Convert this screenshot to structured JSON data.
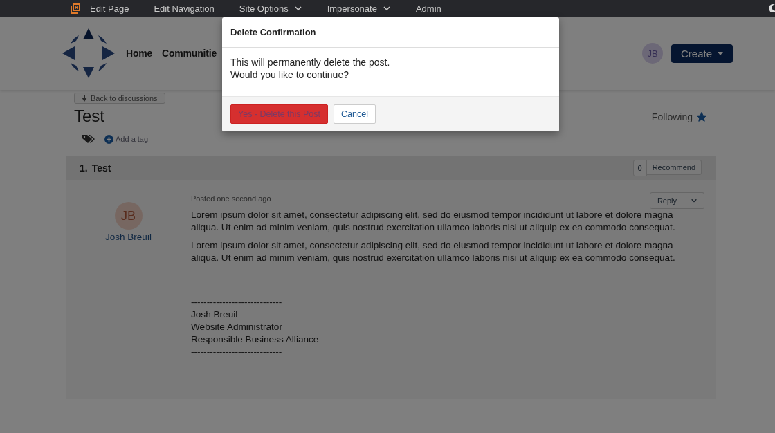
{
  "top_bar": {
    "items": [
      {
        "label": "Edit Page",
        "dropdown": false
      },
      {
        "label": "Edit Navigation",
        "dropdown": false
      },
      {
        "label": "Site Options",
        "dropdown": true
      },
      {
        "label": "Impersonate",
        "dropdown": true
      },
      {
        "label": "Admin",
        "dropdown": false
      }
    ]
  },
  "header": {
    "nav": [
      "Home",
      "Communitie"
    ],
    "avatar": "JB",
    "create_button": "Create"
  },
  "back_button": "Back to discussions",
  "discussion": {
    "title": "Test",
    "add_tag": "Add a tag",
    "following": {
      "label": "Following",
      "on": true
    }
  },
  "post": {
    "number": "1.",
    "title": "Test",
    "recommend_count": "0",
    "recommend": "Recommend",
    "author_initials": "JB",
    "author": "Josh Breuil",
    "posted": "Posted one second ago",
    "reply": "Reply",
    "paragraphs": [
      "Lorem ipsum dolor sit amet, consectetur adipiscing elit, sed do eiusmod tempor incididunt ut labore et dolore magna aliqua. Ut enim ad minim veniam, quis nostrud exercitation ullamco laboris nisi ut aliquip ex ea commodo consequat.",
      "Lorem ipsum dolor sit amet, consectetur adipiscing elit, sed do eiusmod tempor incididunt ut labore et dolore magna aliqua. Ut enim ad minim veniam, quis nostrud exercitation ullamco laboris nisi ut aliquip ex ea commodo consequat."
    ],
    "signature": [
      "-----------------------------",
      "Josh Breuil",
      "Website Administrator",
      "Responsible Business Alliance",
      "-----------------------------"
    ]
  },
  "dialog": {
    "title": "Delete Confirmation",
    "message": [
      "This will permanently delete the post.",
      "Would you like to continue?"
    ],
    "buttons": [
      {
        "label": "Yes - Delete this Post",
        "kind": "danger"
      },
      {
        "label": "Cancel",
        "kind": "secondary"
      }
    ]
  }
}
